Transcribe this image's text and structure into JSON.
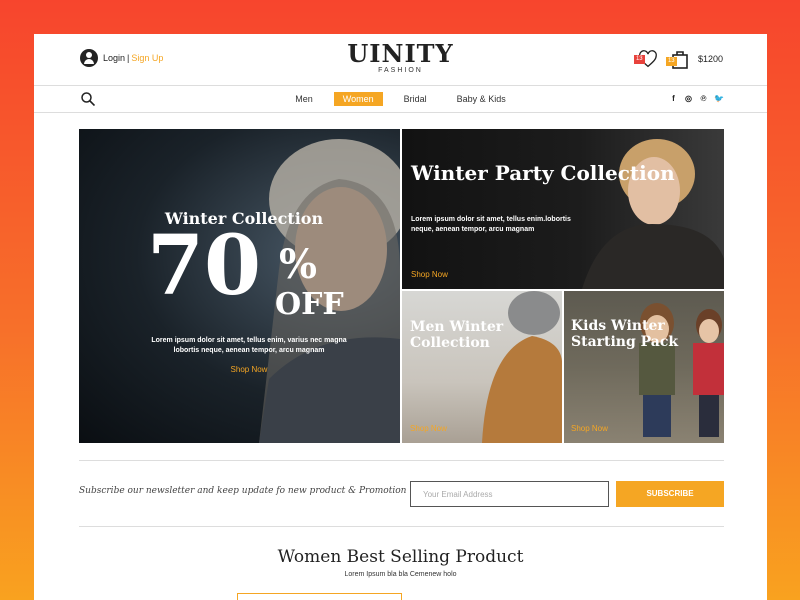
{
  "header": {
    "login_label": "Login",
    "separator": "|",
    "signup_label": "Sign Up",
    "brand": "UINITY",
    "brand_sub": "FASHION",
    "wishlist_count": "13",
    "cart_count": "13",
    "cart_total": "$1200"
  },
  "nav": {
    "items": [
      {
        "label": "Men",
        "active": false
      },
      {
        "label": "Women",
        "active": true
      },
      {
        "label": "Bridal",
        "active": false
      },
      {
        "label": "Baby & Kids",
        "active": false
      }
    ],
    "social": [
      "f",
      "◎",
      "℗",
      "🐦"
    ]
  },
  "hero": {
    "main": {
      "title": "Winter Collection",
      "big": "70",
      "percent": "%",
      "off": "OFF",
      "text": "Lorem ipsum dolor sit amet, tellus enim, varius nec magna lobortis neque, aenean tempor, arcu magnam",
      "cta": "Shop Now"
    },
    "party": {
      "title": "Winter Party Collection",
      "text": "Lorem ipsum dolor sit amet, tellus enim.lobortis neque, aenean tempor, arcu magnam",
      "cta": "Shop Now"
    },
    "men": {
      "title": "Men Winter Collection",
      "cta": "Shop Now"
    },
    "kids": {
      "title": "Kids Winter Starting Pack",
      "cta": "Shop Now"
    }
  },
  "newsletter": {
    "text": "Subscribe our newsletter and  keep update fo new product & Promotion",
    "placeholder": "Your Email Address",
    "button": "SUBSCRIBE"
  },
  "section": {
    "title": "Women Best Selling Product",
    "subtitle": "Lorem Ipsum bla bla Cemenew holo"
  },
  "colors": {
    "accent": "#f5a623",
    "badge_red": "#e8423c"
  }
}
